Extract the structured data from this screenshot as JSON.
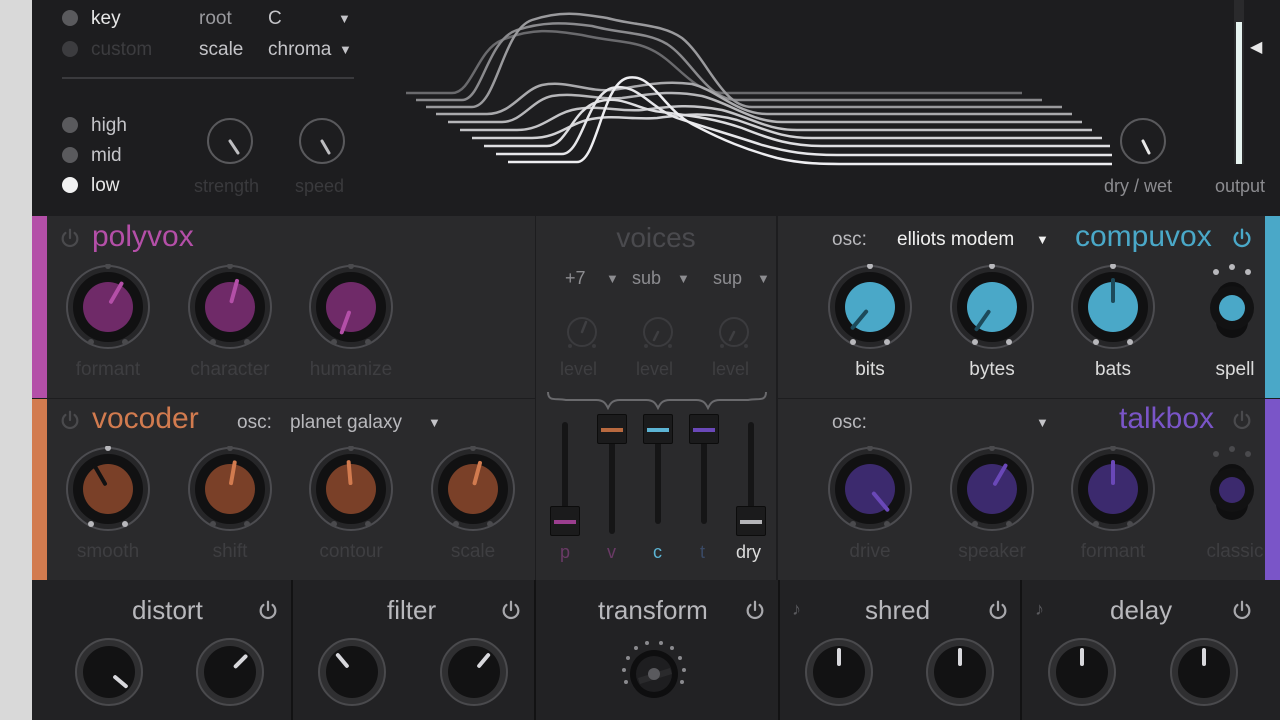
{
  "top": {
    "key_mode": {
      "key": "key",
      "custom": "custom"
    },
    "root": {
      "label": "root",
      "value": "C"
    },
    "scale": {
      "label": "scale",
      "value": "chroma"
    },
    "bands": {
      "high": "high",
      "mid": "mid",
      "low": "low",
      "selected": "low"
    },
    "strength_label": "strength",
    "speed_label": "speed",
    "drywet_label": "dry / wet",
    "output_label": "output",
    "output_level": 0.9
  },
  "polyvox": {
    "title": "polyvox",
    "color": "#b44fa8",
    "knobs": [
      "formant",
      "character",
      "humanize"
    ]
  },
  "voices": {
    "title": "voices",
    "selects": [
      "+7",
      "sub",
      "sup"
    ],
    "level_labels": [
      "level",
      "level",
      "level"
    ],
    "mixer_labels": [
      "p",
      "v",
      "c",
      "t",
      "dry"
    ]
  },
  "compuvox": {
    "title": "compuvox",
    "color": "#4aa8c8",
    "osc_label": "osc:",
    "osc_value": "elliots modem",
    "knobs": [
      "bits",
      "bytes",
      "bats",
      "spell"
    ]
  },
  "vocoder": {
    "title": "vocoder",
    "color": "#d27b4f",
    "osc_label": "osc:",
    "osc_value": "planet galaxy",
    "knobs": [
      "smooth",
      "shift",
      "contour",
      "scale"
    ]
  },
  "talkbox": {
    "title": "talkbox",
    "color": "#7a55c8",
    "osc_label": "osc:",
    "knobs": [
      "drive",
      "speaker",
      "formant",
      "classic"
    ]
  },
  "fx": {
    "distort": "distort",
    "filter": "filter",
    "transform": "transform",
    "shred": "shred",
    "delay": "delay"
  },
  "icons": {
    "power": "power-icon",
    "dropdown": "dropdown-caret-icon",
    "note": "note-icon"
  }
}
